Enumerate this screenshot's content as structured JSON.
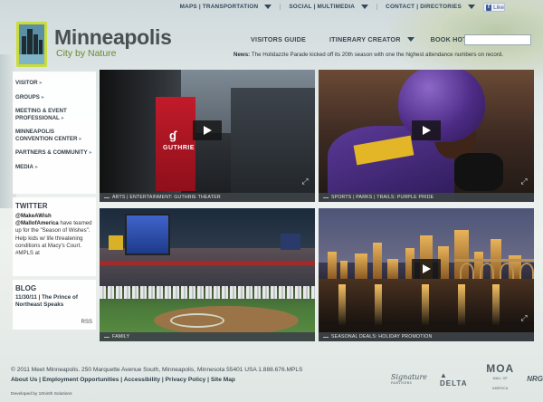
{
  "topnav": [
    {
      "label": "MAPS | TRANSPORTATION"
    },
    {
      "label": "SOCIAL | MULTIMEDIA"
    },
    {
      "label": "CONTACT | DIRECTORIES"
    }
  ],
  "like_label": "Like",
  "brand": {
    "name": "Minneapolis",
    "tagline": "City by Nature"
  },
  "mainnav": [
    {
      "label": "VISITORS GUIDE"
    },
    {
      "label": "ITINERARY CREATOR"
    },
    {
      "label": "BOOK HOTEL"
    }
  ],
  "search": {
    "value": ""
  },
  "news": {
    "label": "News:",
    "text": "The Holidazzle Parade kicked off its 20th season with one the highest attendance numbers on record."
  },
  "sidebar": {
    "items": [
      {
        "label": "VISITOR"
      },
      {
        "label": "GROUPS"
      },
      {
        "label": "MEETING & EVENT PROFESSIONAL"
      },
      {
        "label": "MINNEAPOLIS CONVENTION CENTER"
      },
      {
        "label": "PARTNERS & COMMUNITY"
      },
      {
        "label": "MEDIA"
      }
    ]
  },
  "twitter": {
    "title": "TWITTER",
    "handle1": "@MakeAWish",
    "handle2": "@MallofAmerica",
    "text": "have teamed up for the \"Season of Wishes\". Help kids w/ life threatening conditions at Macy's Court. #MPLS at"
  },
  "blog": {
    "title": "BLOG",
    "entry": "11/30/11 | The Prince of Northeast Speaks",
    "rss": "RSS"
  },
  "tiles": [
    {
      "caption": "ARTS | ENTERTAINMENT: GUTHRIE THEATER",
      "sign": "GUTHRIE"
    },
    {
      "caption": "SPORTS | PARKS | TRAILS: PURPLE PRIDE"
    },
    {
      "caption": "FAMILY"
    },
    {
      "caption": "SEASONAL DEALS: HOLIDAY PROMOTION"
    }
  ],
  "footer": {
    "address": "© 2011 Meet Minneapolis. 250 Marquette Avenue South, Minneapolis, Minnesota 55401 USA 1.888.676.MPLS",
    "links": [
      "About Us",
      "Employment Opportunities",
      "Accessibility",
      "Privacy Policy",
      "Site Map"
    ],
    "developed": "Developed by 10ninth Solutions"
  },
  "sponsors": [
    {
      "name": "Signature",
      "sub": "PARTNERS"
    },
    {
      "name": "DELTA"
    },
    {
      "name": "MOA",
      "sub": "MALL OF AMERICA"
    },
    {
      "name": "NRG"
    }
  ]
}
